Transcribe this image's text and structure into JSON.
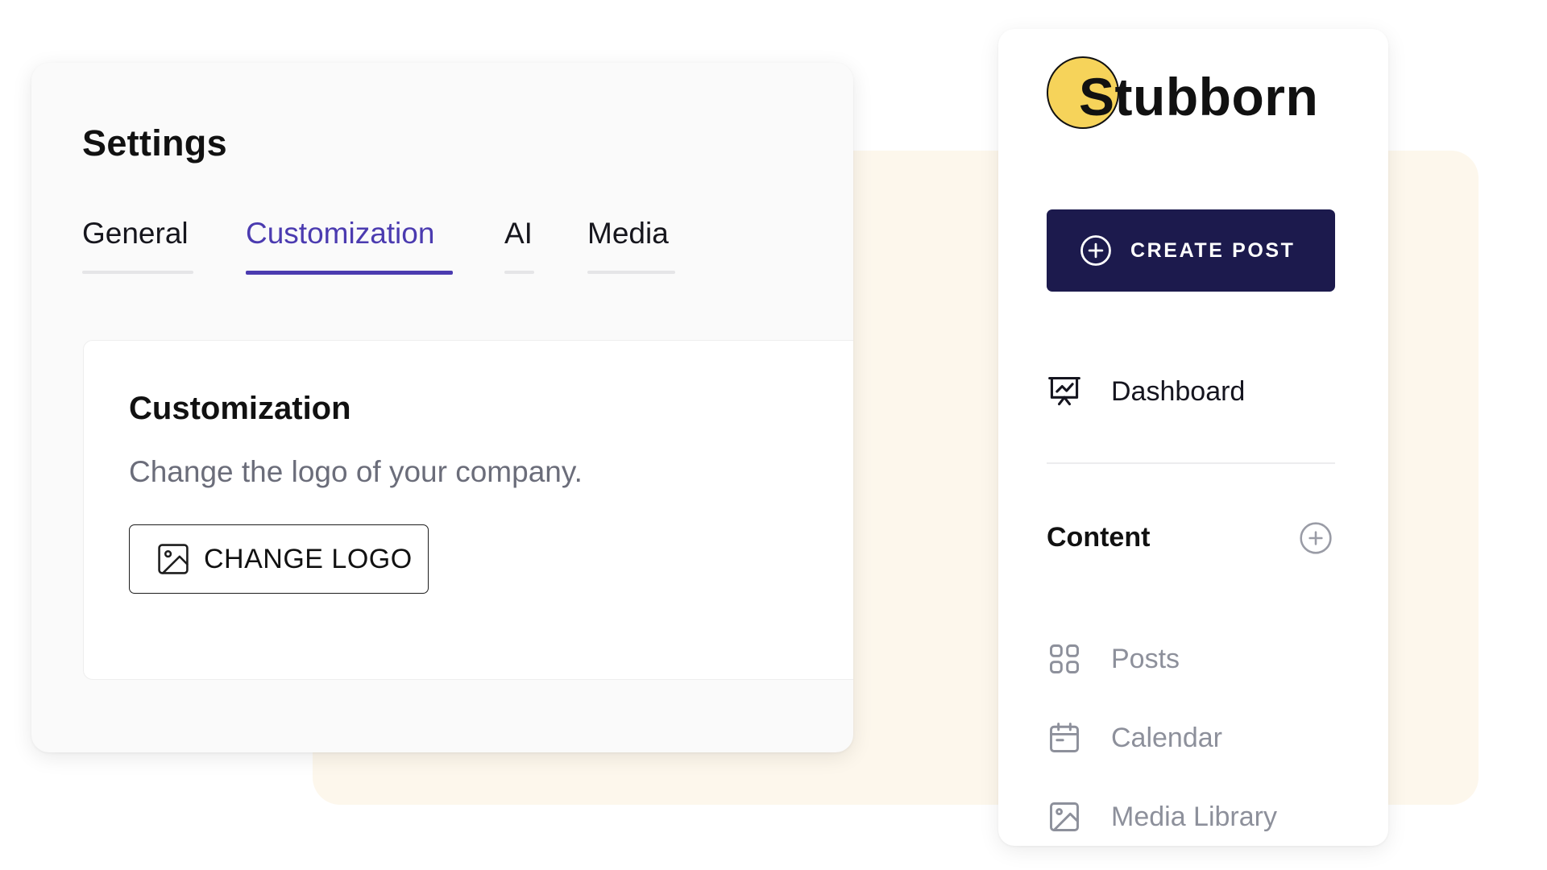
{
  "settings": {
    "title": "Settings",
    "tabs": [
      {
        "label": "General",
        "active": false
      },
      {
        "label": "Customization",
        "active": true
      },
      {
        "label": "AI",
        "active": false
      },
      {
        "label": "Media",
        "active": false
      }
    ],
    "panel": {
      "title": "Customization",
      "description": "Change the logo of your company.",
      "change_logo_label": "CHANGE LOGO",
      "change_logo_icon": "image-icon"
    }
  },
  "sidebar": {
    "brand": {
      "name": "Stubborn",
      "circle_color": "#f6d35a"
    },
    "create_post": {
      "label": "CREATE POST",
      "icon": "plus-circle-icon",
      "background": "#1c1a4d"
    },
    "dashboard": {
      "label": "Dashboard",
      "icon": "presentation-chart-icon"
    },
    "content": {
      "heading": "Content",
      "add_icon": "plus-circle-icon",
      "items": [
        {
          "label": "Posts",
          "icon": "grid-icon"
        },
        {
          "label": "Calendar",
          "icon": "calendar-icon"
        },
        {
          "label": "Media Library",
          "icon": "image-icon"
        }
      ]
    }
  },
  "colors": {
    "accent": "#4b3bb0",
    "cream_background": "#fdf7ec",
    "muted_text": "#8d909b"
  }
}
